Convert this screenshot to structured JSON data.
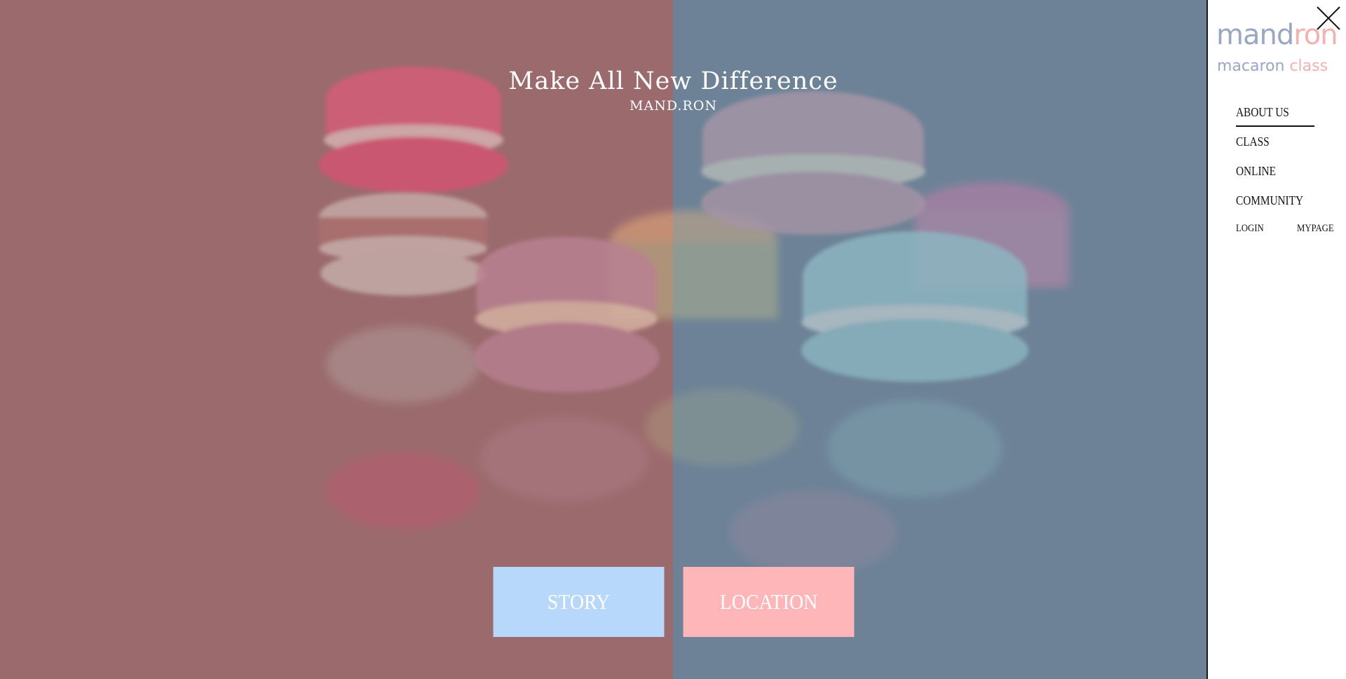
{
  "hero": {
    "title": "Make All New Difference",
    "subtitle": "MAND.RON",
    "left_color": "#9b6b6d",
    "right_color": "#6d8297"
  },
  "buttons": {
    "story_label": "STORY",
    "location_label": "LOCATION",
    "story_color": "#b7d8fb",
    "location_color": "#feb6b8"
  },
  "sidebar": {
    "logo_word_a": "mand",
    "logo_word_b": "ron",
    "logo_sub_a": "macaron ",
    "logo_sub_b": "class",
    "close_icon": "close-icon",
    "nav": [
      {
        "label": "ABOUT US"
      },
      {
        "label": "CLASS"
      },
      {
        "label": "ONLINE"
      },
      {
        "label": "COMMUNITY"
      }
    ],
    "login_label": "LOGIN",
    "mypage_label": "MYPAGE"
  }
}
